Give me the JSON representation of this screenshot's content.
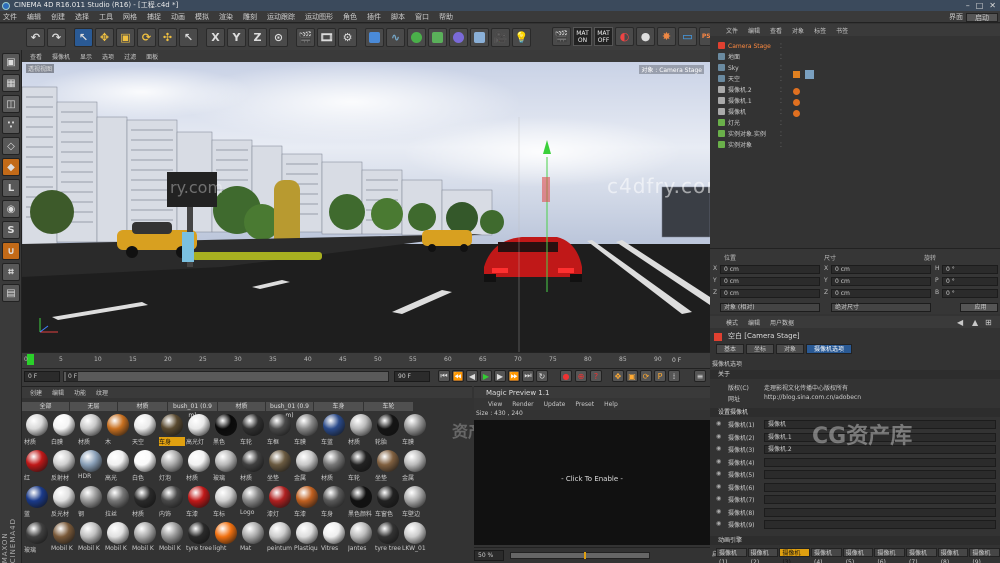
{
  "app": {
    "title": "CINEMA 4D R16.011 Studio (R16) - [工程.c4d *]"
  },
  "menu": [
    "文件",
    "编辑",
    "创建",
    "选择",
    "工具",
    "网格",
    "捕捉",
    "动画",
    "模拟",
    "渲染",
    "雕刻",
    "运动跟踪",
    "运动图形",
    "角色",
    "插件",
    "脚本",
    "窗口",
    "帮助"
  ],
  "layout": {
    "label": "界面",
    "value": "启动"
  },
  "viewport": {
    "menu": [
      "查看",
      "摄像机",
      "显示",
      "选项",
      "过滤",
      "面板"
    ],
    "label": "透视视图",
    "camera_label": "对象 : Camera Stage",
    "watermark": "c4dfry.com",
    "watermark2": "ry.com"
  },
  "timeline": {
    "ticks": [
      "0",
      "5",
      "10",
      "15",
      "20",
      "25",
      "30",
      "35",
      "40",
      "45",
      "50",
      "55",
      "60",
      "65",
      "70",
      "75",
      "80",
      "85",
      "90"
    ],
    "frame_end": "0 F",
    "start_field": "0 F",
    "current_field": "0 F",
    "end_field": "90 F",
    "end_field2": "90 F"
  },
  "materials": {
    "menu": [
      "创建",
      "编辑",
      "功能",
      "纹理"
    ],
    "tabs": [
      "全部",
      "无层",
      "材质",
      "bush_01 (0.9 m)",
      "材质",
      "bush_01 (0.9 m)",
      "车身",
      "车轮"
    ],
    "row1": [
      "材质",
      "白膜",
      "材质",
      "木",
      "天空",
      "车身",
      "高光灯",
      "黑色",
      "车轮",
      "车框",
      "车膜",
      "车蓝",
      "材质",
      "轮胎",
      "车膜"
    ],
    "row2": [
      "红",
      "反射材",
      "HDR",
      "高光",
      "白色",
      "灯泡",
      "材质",
      "玻璃",
      "材质",
      "坐垫",
      "金属",
      "材质",
      "车轮",
      "坐垫",
      "金属"
    ],
    "row3": [
      "蓝",
      "反光材",
      "钢",
      "拉丝",
      "材质",
      "内饰",
      "车漆",
      "车标",
      "Logo",
      "漆灯",
      "车漆",
      "车身",
      "黑色颜料",
      "车窗色",
      "车壁边"
    ],
    "row4": [
      "玻璃",
      "Mobil K",
      "Mobil K",
      "Mobil K",
      "Mobil K",
      "Mobil K",
      "tyre tree",
      "light",
      "Mat",
      "peintum",
      "Plastiqu",
      "Vitres",
      "Jantes",
      "tyre tree",
      "LKW_01"
    ]
  },
  "preview": {
    "title": "Magic Preview 1.1",
    "menu": [
      "View",
      "Render",
      "Update",
      "Preset",
      "Help"
    ],
    "size": "Size : 430 , 240",
    "click": "- Click To Enable -",
    "zoom": "50 %"
  },
  "objects": {
    "menu": [
      "文件",
      "编辑",
      "查看",
      "对象",
      "标签",
      "书签"
    ],
    "rows": [
      {
        "name": "Camera Stage",
        "color": "#e04030",
        "highlight": true
      },
      {
        "name": "地面",
        "color": "#6a8aa0"
      },
      {
        "name": "Sky",
        "color": "#6a8aa0"
      },
      {
        "name": "天空",
        "color": "#6a8aa0"
      },
      {
        "name": "摄像机.2",
        "color": "#aaaaaa"
      },
      {
        "name": "摄像机.1",
        "color": "#aaaaaa"
      },
      {
        "name": "摄像机",
        "color": "#aaaaaa"
      },
      {
        "name": "灯光",
        "color": "#6ab04a"
      },
      {
        "name": "实例对象.实例",
        "color": "#6ab04a"
      },
      {
        "name": "实例对象",
        "color": "#6ab04a"
      }
    ]
  },
  "coords": {
    "headers": [
      "位置",
      "尺寸",
      "旋转"
    ],
    "rows": [
      {
        "axis": "X",
        "pos": "0 cm",
        "size_axis": "X",
        "size": "0 cm",
        "rot_axis": "H",
        "rot": "0 °"
      },
      {
        "axis": "Y",
        "pos": "0 cm",
        "size_axis": "Y",
        "size": "0 cm",
        "rot_axis": "P",
        "rot": "0 °"
      },
      {
        "axis": "Z",
        "pos": "0 cm",
        "size_axis": "Z",
        "size": "0 cm",
        "rot_axis": "B",
        "rot": "0 °"
      }
    ],
    "mode": "对象 (相对)",
    "size_mode": "绝对尺寸",
    "apply": "应用"
  },
  "attributes": {
    "menu": [
      "模式",
      "编辑",
      "用户数据"
    ],
    "title": "空白 [Camera Stage]",
    "tabs": [
      "基本",
      "坐标",
      "对象",
      "摄像机选项"
    ],
    "section_title": "摄像机选项",
    "about": "关于",
    "copyright_label": "版权(C)",
    "copyright": "走理影视文化传播中心版权所有",
    "website_label": "网址",
    "website": "http://blog.sina.com.cn/adobecn",
    "settings_title": "设置摄像机",
    "cam_rows": [
      {
        "label": "摄像机(1)",
        "value": "摄像机"
      },
      {
        "label": "摄像机(2)",
        "value": "摄像机.1"
      },
      {
        "label": "摄像机(3)",
        "value": "摄像机.2"
      },
      {
        "label": "摄像机(4)",
        "value": ""
      },
      {
        "label": "摄像机(5)",
        "value": ""
      },
      {
        "label": "摄像机(6)",
        "value": ""
      },
      {
        "label": "摄像机(7)",
        "value": ""
      },
      {
        "label": "摄像机(8)",
        "value": ""
      },
      {
        "label": "摄像机(9)",
        "value": ""
      }
    ],
    "anim_title": "动画引擎",
    "start_label": "启动",
    "cam_tabs": [
      "摄像机(1)",
      "摄像机(2)",
      "摄像机(3)",
      "摄像机(4)",
      "摄像机(5)",
      "摄像机(6)",
      "摄像机(7)",
      "摄像机(8)",
      "摄像机(9)"
    ]
  },
  "watermarks": {
    "cg": "CG资产库",
    "cg_left": "资产库"
  },
  "logo_vertical": "MAXON CINEMA4D"
}
